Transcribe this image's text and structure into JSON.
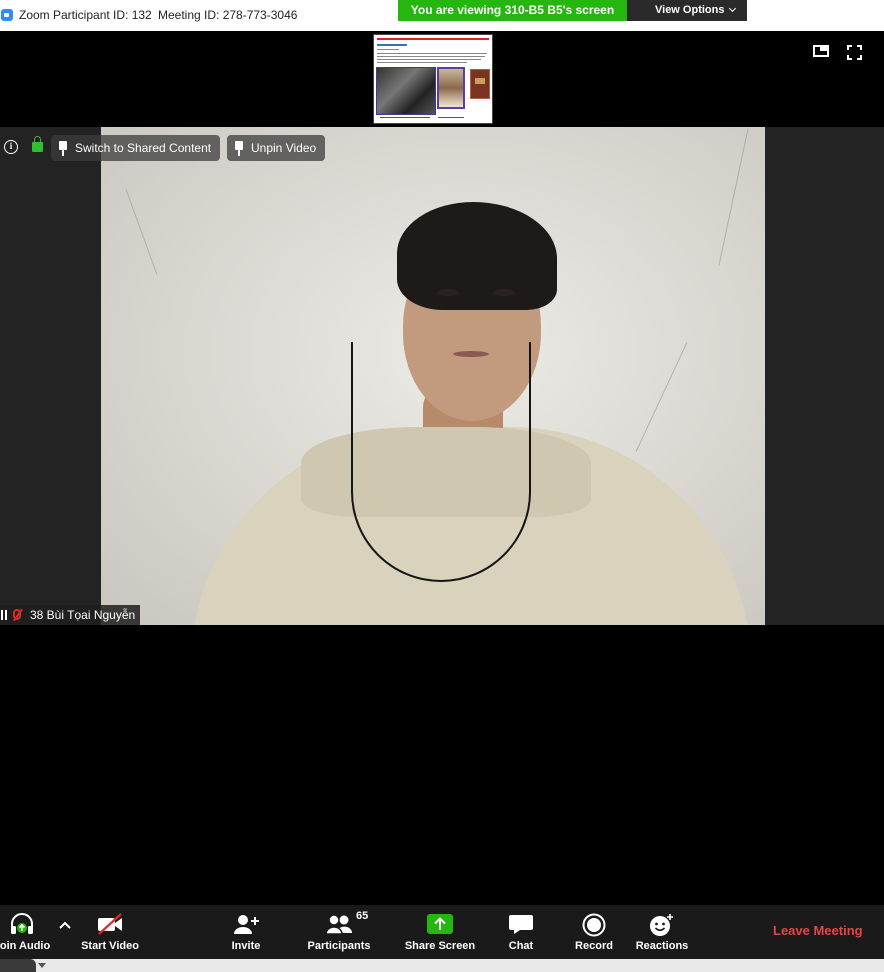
{
  "titlebar": {
    "title": "Zoom Participant ID: 132",
    "meeting_id": "Meeting ID: 278-773-3046"
  },
  "share_banner": {
    "text": "You are viewing 310-B5 B5's screen",
    "view_options": "View Options",
    "color": "#25b60f"
  },
  "overlay": {
    "switch_label": "Switch to Shared Content",
    "unpin_label": "Unpin Video"
  },
  "participant": {
    "name": "38 Bùi Tọai Nguyễn",
    "mic_muted": true
  },
  "toolbar": {
    "join_audio": "Join Audio",
    "start_video": "Start Video",
    "invite": "Invite",
    "participants": "Participants",
    "participants_count": "65",
    "share_screen": "Share Screen",
    "chat": "Chat",
    "record": "Record",
    "reactions": "Reactions",
    "leave": "Leave Meeting",
    "leave_color": "#e54545",
    "share_color": "#25b60f"
  },
  "icons": [
    "zoom-app-icon",
    "chevron-down-icon",
    "minimize-view-icon",
    "fullscreen-icon",
    "info-icon",
    "lock-icon",
    "pin-icon",
    "signal-icon",
    "mic-muted-icon",
    "headphones-icon",
    "chevron-up-icon",
    "video-off-icon",
    "add-user-icon",
    "participants-icon",
    "share-arrow-icon",
    "chat-icon",
    "record-icon",
    "reactions-icon"
  ]
}
